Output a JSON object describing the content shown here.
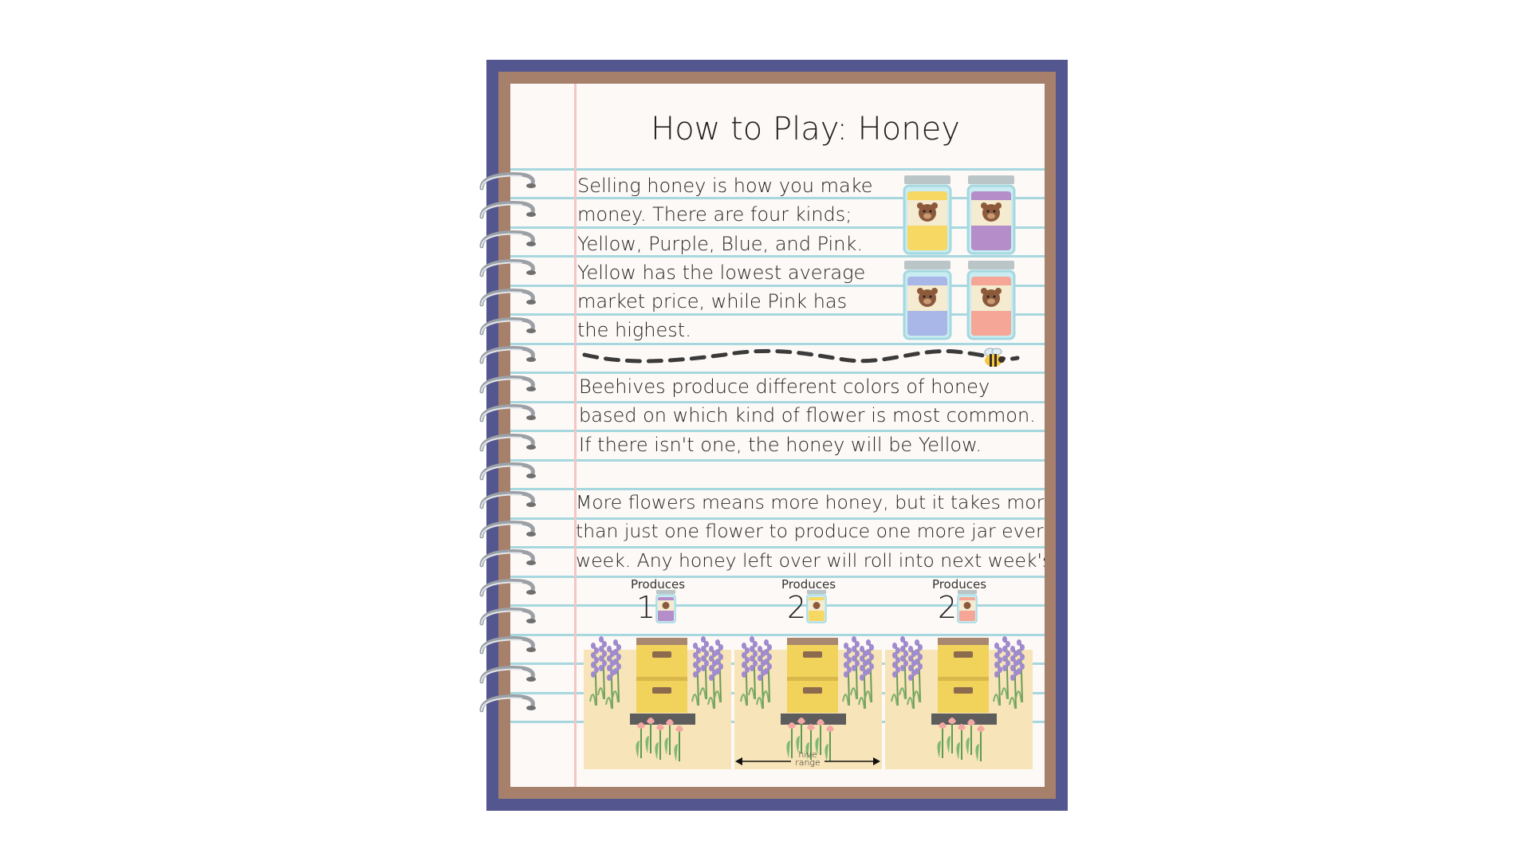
{
  "page": {
    "title": "How to Play: Honey"
  },
  "intro": {
    "lines": [
      "Selling honey is how you make",
      "money. There are four kinds;",
      "Yellow, Purple, Blue, and Pink.",
      "Yellow has the lowest average",
      "market price, while Pink has",
      "the highest."
    ]
  },
  "honey_colors": {
    "yellow": "#f6d863",
    "purple": "#b58ec9",
    "blue": "#a9b6e8",
    "pink": "#f6a696"
  },
  "hive_text": {
    "lines": [
      "Beehives produce different colors of honey",
      "based on which kind of flower is most common.",
      "If there isn't one, the honey will be Yellow."
    ]
  },
  "flower_text": {
    "lines": [
      "More flowers means more honey, but it takes more",
      "than just one flower to produce one more jar every",
      "week. Any honey left over will roll into next week's!"
    ]
  },
  "examples": [
    {
      "produces_label": "Produces",
      "count": "1",
      "jar_color": "purple"
    },
    {
      "produces_label": "Produces",
      "count": "2",
      "jar_color": "yellow"
    },
    {
      "produces_label": "Produces",
      "count": "2",
      "jar_color": "pink"
    }
  ],
  "hive_range": {
    "label_line1": "hive",
    "label_line2": "range"
  }
}
